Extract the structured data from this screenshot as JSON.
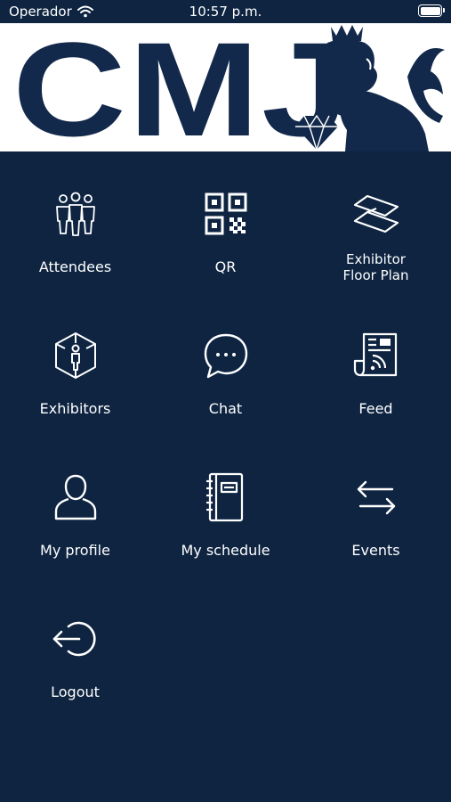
{
  "status_bar": {
    "carrier": "Operador",
    "time": "10:57 p.m."
  },
  "header": {
    "brand": "CMJ"
  },
  "menu": [
    {
      "label": "Attendees",
      "icon": "attendees-icon"
    },
    {
      "label": "QR",
      "icon": "qr-code-icon"
    },
    {
      "label_line1": "Exhibitor",
      "label_line2": "Floor Plan",
      "icon": "floor-plan-icon"
    },
    {
      "label": "Exhibitors",
      "icon": "exhibitors-icon"
    },
    {
      "label": "Chat",
      "icon": "chat-icon"
    },
    {
      "label": "Feed",
      "icon": "feed-icon"
    },
    {
      "label": "My profile",
      "icon": "profile-icon"
    },
    {
      "label": "My schedule",
      "icon": "schedule-icon"
    },
    {
      "label": "Events",
      "icon": "events-icon"
    },
    {
      "label": "Logout",
      "icon": "logout-icon"
    }
  ],
  "colors": {
    "background": "#0e2441",
    "brand": "#13294b",
    "header_bg": "#ffffff",
    "foreground": "#ffffff"
  }
}
